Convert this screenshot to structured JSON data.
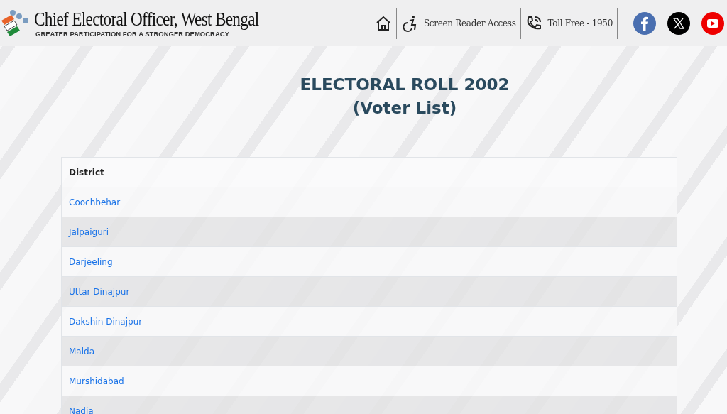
{
  "header": {
    "title": "Chief Electoral Officer, West Bengal",
    "tagline": "GREATER PARTICIPATION FOR A STRONGER DEMOCRACY",
    "screen_reader": "Screen Reader Access",
    "toll_free": "Toll Free - 1950"
  },
  "heading": {
    "line1": "ELECTORAL ROLL 2002",
    "line2": "(Voter List)"
  },
  "table": {
    "columns": [
      "District"
    ],
    "rows": [
      "Coochbehar",
      "Jalpaiguri",
      "Darjeeling",
      "Uttar Dinajpur",
      "Dakshin Dinajpur",
      "Malda",
      "Murshidabad",
      "Nadia"
    ]
  }
}
